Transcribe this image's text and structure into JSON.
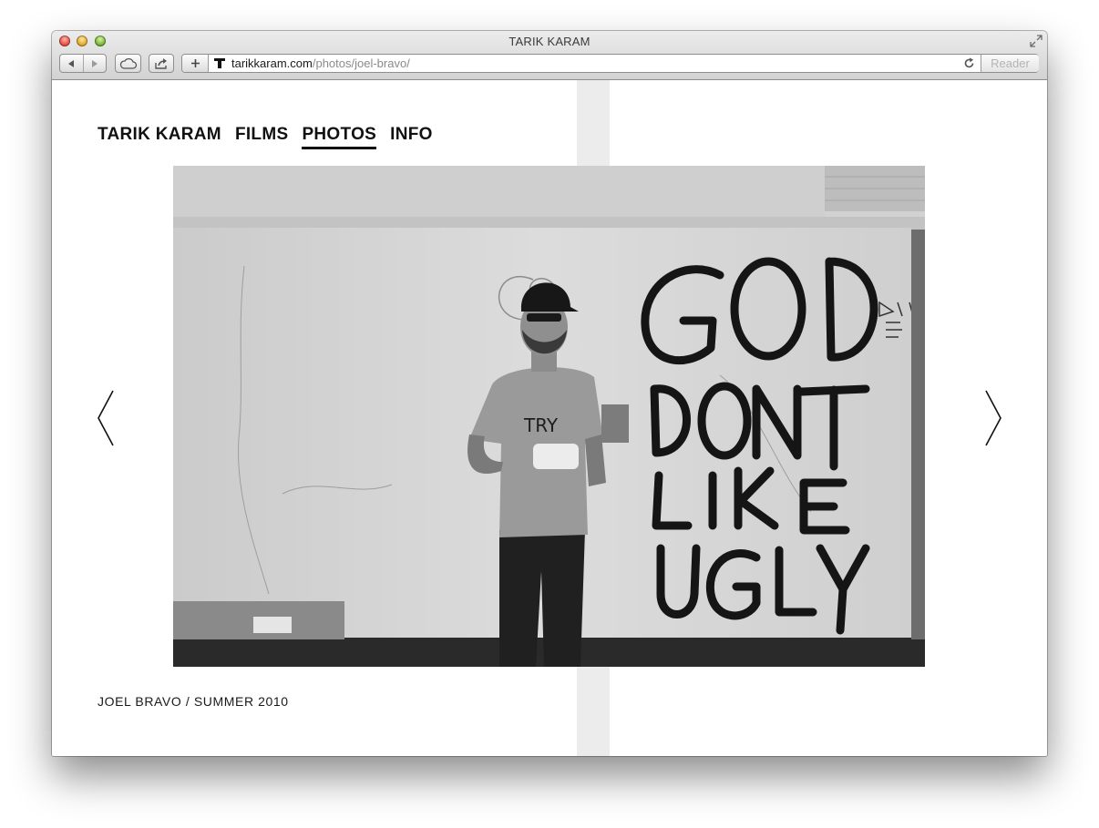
{
  "browser": {
    "window_title": "TARIK KARAM",
    "address": {
      "domain": "tarikkaram.com",
      "path": "/photos/joel-bravo/"
    },
    "reader_label": "Reader"
  },
  "site": {
    "nav": [
      {
        "label": "TARIK KARAM",
        "active": false
      },
      {
        "label": "FILMS",
        "active": false
      },
      {
        "label": "PHOTOS",
        "active": true
      },
      {
        "label": "INFO",
        "active": false
      }
    ],
    "photo": {
      "graffiti_text": "GOD DONT LIKE UGLY",
      "shirt_text": "TRY"
    },
    "caption": "JOEL BRAVO / SUMMER 2010"
  },
  "colors": {
    "text": "#111111",
    "stripe": "#ececec"
  },
  "icons": [
    "back-arrow-icon",
    "forward-arrow-icon",
    "icloud-icon",
    "share-icon",
    "plus-icon",
    "favicon-icon",
    "reload-icon",
    "fullscreen-icon",
    "chevron-left-icon",
    "chevron-right-icon"
  ]
}
